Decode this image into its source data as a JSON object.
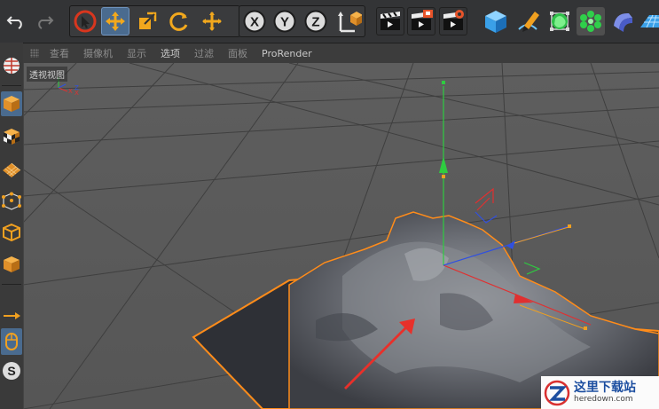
{
  "toolbar": {
    "buttons": [
      {
        "name": "undo",
        "icon": "undo-icon"
      },
      {
        "name": "redo",
        "icon": "redo-icon"
      },
      {
        "name": "select",
        "icon": "cursor-select-icon"
      },
      {
        "name": "move",
        "icon": "move-icon",
        "active": true
      },
      {
        "name": "scale",
        "icon": "scale-icon"
      },
      {
        "name": "rotate",
        "icon": "rotate-icon"
      },
      {
        "name": "add-move",
        "icon": "move-plus-icon"
      },
      {
        "name": "axis-x",
        "label": "X"
      },
      {
        "name": "axis-y",
        "label": "Y"
      },
      {
        "name": "axis-z",
        "label": "Z"
      },
      {
        "name": "coordinate-system",
        "icon": "coordinate-system-icon"
      },
      {
        "name": "render-view",
        "icon": "render-clapper-icon"
      },
      {
        "name": "render-picture-viewer",
        "icon": "render-region-icon"
      },
      {
        "name": "render-settings",
        "icon": "render-settings-icon"
      },
      {
        "name": "cube",
        "icon": "cube-icon"
      },
      {
        "name": "pen",
        "icon": "pen-spline-icon"
      },
      {
        "name": "subdivision",
        "icon": "subdivision-surface-icon"
      },
      {
        "name": "cloner",
        "icon": "cloner-icon"
      },
      {
        "name": "deformer",
        "icon": "bend-deformer-icon"
      },
      {
        "name": "floor",
        "icon": "floor-grid-icon"
      }
    ]
  },
  "viewport_menu": {
    "items": [
      "查看",
      "摄像机",
      "显示",
      "选项",
      "过滤",
      "面板",
      "ProRender"
    ],
    "active_index": 3
  },
  "viewport": {
    "label": "透视视图",
    "background": "#5b5b5b"
  },
  "watermark": {
    "title": "这里下载站",
    "url": "heredown.com"
  },
  "colors": {
    "accent_active": "#4a6b8f",
    "axis_x": "#e03030",
    "axis_y": "#2ecc40",
    "axis_z": "#3050e0",
    "handle": "#f0a020",
    "selection_outline": "#ff8c1a",
    "annotation_arrow": "#e8302a"
  }
}
